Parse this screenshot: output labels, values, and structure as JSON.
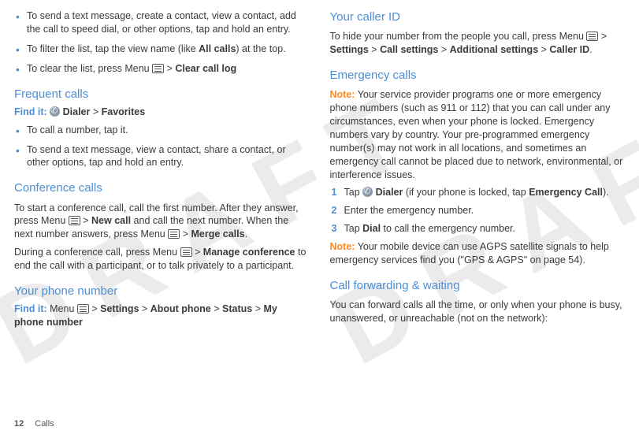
{
  "watermark": "DRAFT",
  "footer": {
    "page_num": "12",
    "section": "Calls"
  },
  "col1": {
    "bullets1": [
      {
        "pre": "To send a text message, create a contact, view a contact, add the call to speed dial, or other options, tap and hold an entry."
      },
      {
        "pre": "To filter the list, tap the view name (like ",
        "bold1": "All calls",
        "post1": ") at the top."
      },
      {
        "pre": "To clear the list, press Menu ",
        "show_menu_icon": true,
        "post_icon": " > ",
        "bold1": "Clear call log"
      }
    ],
    "freq": {
      "heading": "Frequent calls",
      "findit_label": "Find it:",
      "dialer": "Dialer",
      "sep": " > ",
      "favorites": "Favorites",
      "bullets": [
        {
          "text": "To call a number, tap it."
        },
        {
          "text": "To send a text message, view a contact, share a contact, or other options, tap and hold an entry."
        }
      ]
    },
    "conf": {
      "heading": "Conference calls",
      "p1a": "To start a conference call, call the first number. After they answer, press Menu ",
      "p1b": " > ",
      "p1_bold1": "New call",
      "p1c": " and call the next number. When the next number answers, press Menu ",
      "p1d": " > ",
      "p1_bold2": "Merge calls",
      "p1e": ".",
      "p2a": "During a conference call, press Menu ",
      "p2b": " > ",
      "p2_bold1": "Manage conference",
      "p2c": " to end the call with a participant, or to talk privately to a participant."
    },
    "ypn": {
      "heading": "Your phone number",
      "findit_label": "Find it:",
      "pre": " Menu ",
      "path": [
        "Settings",
        "About phone",
        "Status",
        "My phone number"
      ]
    }
  },
  "col2": {
    "cid": {
      "heading": "Your caller ID",
      "p1a": "To hide your number from the people you call, press Menu ",
      "p1b": " > ",
      "path": [
        "Settings",
        "Call settings",
        "Additional settings",
        "Caller ID"
      ],
      "p1c": "."
    },
    "emerg": {
      "heading": "Emergency calls",
      "note_label": "Note:",
      "note_text": " Your service provider programs one or more emergency phone numbers (such as 911 or 112) that you can call under any circumstances, even when your phone is locked. Emergency numbers vary by country. Your pre-programmed emergency number(s) may not work in all locations, and sometimes an emergency call cannot be placed due to network, environmental, or interference issues.",
      "steps": [
        {
          "n": "1",
          "pre": "Tap ",
          "show_dialer": true,
          "bold1": "Dialer",
          "mid": " (if your phone is locked, tap ",
          "bold2": "Emergency Call",
          "post": ")."
        },
        {
          "n": "2",
          "pre": "Enter the emergency number."
        },
        {
          "n": "3",
          "pre": "Tap ",
          "bold1": "Dial",
          "post": " to call the emergency number."
        }
      ],
      "note2_label": "Note:",
      "note2_text": " Your mobile device can use AGPS satellite signals to help emergency services find you (\"GPS & AGPS\" on page 54)."
    },
    "cfw": {
      "heading": "Call forwarding & waiting",
      "p1": "You can forward calls all the time, or only when your phone is busy, unanswered, or unreachable (not on the network):"
    }
  }
}
